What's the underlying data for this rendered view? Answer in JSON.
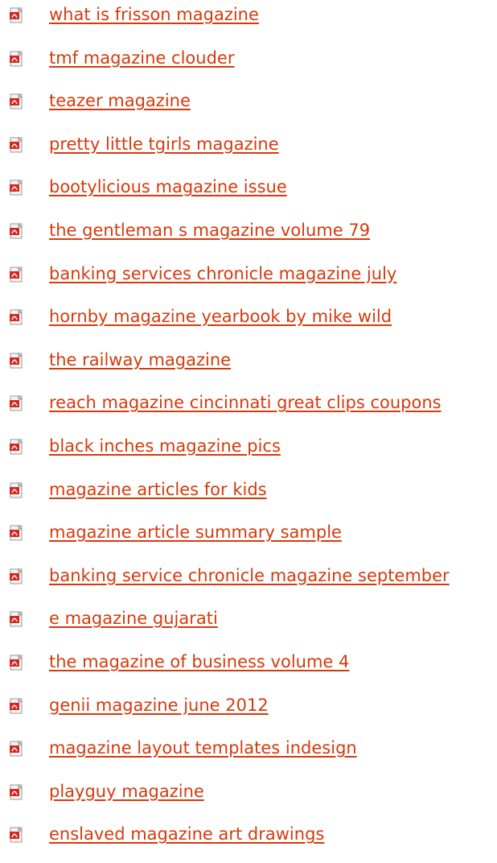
{
  "links": [
    {
      "label": "what is frisson magazine",
      "icon": "pdf-file-icon"
    },
    {
      "label": "tmf magazine clouder",
      "icon": "pdf-file-icon"
    },
    {
      "label": "teazer magazine",
      "icon": "pdf-file-icon"
    },
    {
      "label": "pretty little tgirls magazine",
      "icon": "pdf-file-icon"
    },
    {
      "label": "bootylicious magazine issue",
      "icon": "pdf-file-icon"
    },
    {
      "label": "the gentleman s magazine volume 79",
      "icon": "pdf-file-icon"
    },
    {
      "label": "banking services chronicle magazine july",
      "icon": "pdf-file-icon"
    },
    {
      "label": "hornby magazine yearbook by mike wild",
      "icon": "pdf-file-icon"
    },
    {
      "label": "the railway magazine",
      "icon": "pdf-file-icon"
    },
    {
      "label": "reach magazine cincinnati great clips coupons",
      "icon": "pdf-file-icon"
    },
    {
      "label": "black inches magazine pics",
      "icon": "pdf-file-icon"
    },
    {
      "label": "magazine articles for kids",
      "icon": "pdf-file-icon"
    },
    {
      "label": "magazine article summary sample",
      "icon": "pdf-file-icon"
    },
    {
      "label": "banking service chronicle magazine september",
      "icon": "pdf-file-icon"
    },
    {
      "label": "e magazine gujarati",
      "icon": "pdf-file-icon"
    },
    {
      "label": "the magazine of business volume 4",
      "icon": "pdf-file-icon"
    },
    {
      "label": "genii magazine june 2012",
      "icon": "pdf-file-icon"
    },
    {
      "label": "magazine layout templates indesign",
      "icon": "pdf-file-icon"
    },
    {
      "label": "playguy magazine",
      "icon": "pdf-file-icon"
    },
    {
      "label": "enslaved magazine art drawings",
      "icon": "pdf-file-icon"
    }
  ],
  "colors": {
    "link": "#d63a0c",
    "icon_red": "#d8261c"
  }
}
